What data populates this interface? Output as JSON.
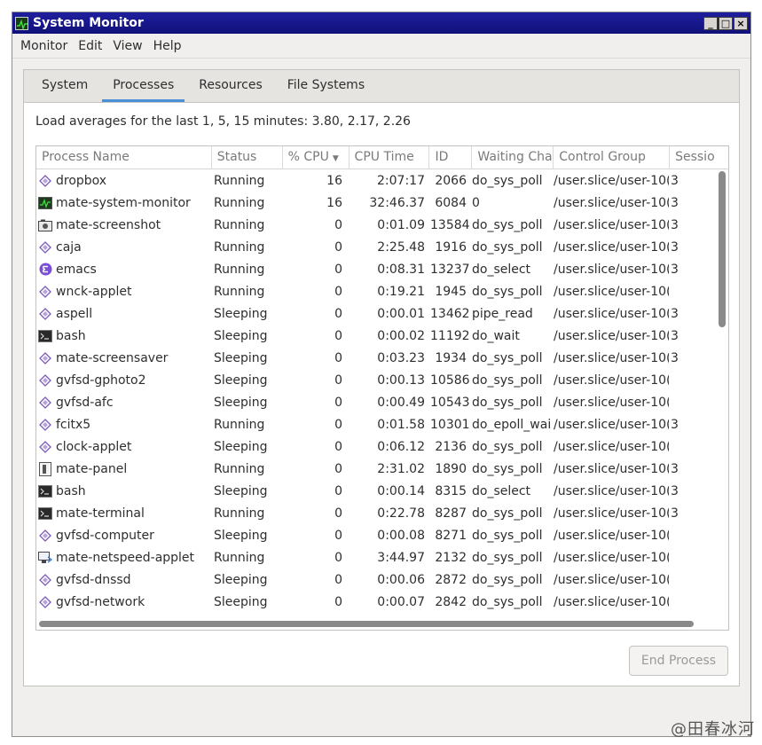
{
  "window": {
    "title": "System Monitor",
    "controls": [
      "_",
      "□",
      "×"
    ]
  },
  "menu": [
    "Monitor",
    "Edit",
    "View",
    "Help"
  ],
  "tabs": [
    "System",
    "Processes",
    "Resources",
    "File Systems"
  ],
  "active_tab": "Processes",
  "load_averages": "Load averages for the last 1, 5, 15 minutes: 3.80, 2.17, 2.26",
  "columns": [
    "Process Name",
    "Status",
    "% CPU",
    "CPU Time",
    "ID",
    "Waiting Cha",
    "Control Group",
    "Sessio"
  ],
  "sort_indicator": "▼",
  "processes": [
    {
      "name": "dropbox",
      "icon": "gear-diamond-icon",
      "status": "Running",
      "cpu": "16",
      "time": "2:07:17",
      "id": "2066",
      "wait": "do_sys_poll",
      "cgroup": "/user.slice/user-10(",
      "sess": "3"
    },
    {
      "name": "mate-system-monitor",
      "icon": "system-monitor-icon",
      "status": "Running",
      "cpu": "16",
      "time": "32:46.37",
      "id": "6084",
      "wait": "0",
      "cgroup": "/user.slice/user-10(",
      "sess": "3"
    },
    {
      "name": "mate-screenshot",
      "icon": "camera-icon",
      "status": "Running",
      "cpu": "0",
      "time": "0:01.09",
      "id": "13584",
      "wait": "do_sys_poll",
      "cgroup": "/user.slice/user-10(",
      "sess": "3"
    },
    {
      "name": "caja",
      "icon": "gear-diamond-icon",
      "status": "Running",
      "cpu": "0",
      "time": "2:25.48",
      "id": "1916",
      "wait": "do_sys_poll",
      "cgroup": "/user.slice/user-10(",
      "sess": "3"
    },
    {
      "name": "emacs",
      "icon": "emacs-icon",
      "status": "Running",
      "cpu": "0",
      "time": "0:08.31",
      "id": "13237",
      "wait": "do_select",
      "cgroup": "/user.slice/user-10(",
      "sess": "3"
    },
    {
      "name": "wnck-applet",
      "icon": "gear-diamond-icon",
      "status": "Running",
      "cpu": "0",
      "time": "0:19.21",
      "id": "1945",
      "wait": "do_sys_poll",
      "cgroup": "/user.slice/user-10(",
      "sess": ""
    },
    {
      "name": "aspell",
      "icon": "gear-diamond-icon",
      "status": "Sleeping",
      "cpu": "0",
      "time": "0:00.01",
      "id": "13462",
      "wait": "pipe_read",
      "cgroup": "/user.slice/user-10(",
      "sess": "3"
    },
    {
      "name": "bash",
      "icon": "terminal-icon",
      "status": "Sleeping",
      "cpu": "0",
      "time": "0:00.02",
      "id": "11192",
      "wait": "do_wait",
      "cgroup": "/user.slice/user-10(",
      "sess": "3"
    },
    {
      "name": "mate-screensaver",
      "icon": "gear-diamond-icon",
      "status": "Sleeping",
      "cpu": "0",
      "time": "0:03.23",
      "id": "1934",
      "wait": "do_sys_poll",
      "cgroup": "/user.slice/user-10(",
      "sess": "3"
    },
    {
      "name": "gvfsd-gphoto2",
      "icon": "gear-diamond-icon",
      "status": "Sleeping",
      "cpu": "0",
      "time": "0:00.13",
      "id": "10586",
      "wait": "do_sys_poll",
      "cgroup": "/user.slice/user-10(",
      "sess": ""
    },
    {
      "name": "gvfsd-afc",
      "icon": "gear-diamond-icon",
      "status": "Sleeping",
      "cpu": "0",
      "time": "0:00.49",
      "id": "10543",
      "wait": "do_sys_poll",
      "cgroup": "/user.slice/user-10(",
      "sess": ""
    },
    {
      "name": "fcitx5",
      "icon": "gear-diamond-icon",
      "status": "Running",
      "cpu": "0",
      "time": "0:01.58",
      "id": "10301",
      "wait": "do_epoll_wai",
      "cgroup": "/user.slice/user-10(",
      "sess": "3"
    },
    {
      "name": "clock-applet",
      "icon": "gear-diamond-icon",
      "status": "Sleeping",
      "cpu": "0",
      "time": "0:06.12",
      "id": "2136",
      "wait": "do_sys_poll",
      "cgroup": "/user.slice/user-10(",
      "sess": ""
    },
    {
      "name": "mate-panel",
      "icon": "panel-icon",
      "status": "Running",
      "cpu": "0",
      "time": "2:31.02",
      "id": "1890",
      "wait": "do_sys_poll",
      "cgroup": "/user.slice/user-10(",
      "sess": "3"
    },
    {
      "name": "bash",
      "icon": "terminal-icon",
      "status": "Sleeping",
      "cpu": "0",
      "time": "0:00.14",
      "id": "8315",
      "wait": "do_select",
      "cgroup": "/user.slice/user-10(",
      "sess": "3"
    },
    {
      "name": "mate-terminal",
      "icon": "terminal-icon",
      "status": "Running",
      "cpu": "0",
      "time": "0:22.78",
      "id": "8287",
      "wait": "do_sys_poll",
      "cgroup": "/user.slice/user-10(",
      "sess": "3"
    },
    {
      "name": "gvfsd-computer",
      "icon": "gear-diamond-icon",
      "status": "Sleeping",
      "cpu": "0",
      "time": "0:00.08",
      "id": "8271",
      "wait": "do_sys_poll",
      "cgroup": "/user.slice/user-10(",
      "sess": ""
    },
    {
      "name": "mate-netspeed-applet",
      "icon": "network-icon",
      "status": "Running",
      "cpu": "0",
      "time": "3:44.97",
      "id": "2132",
      "wait": "do_sys_poll",
      "cgroup": "/user.slice/user-10(",
      "sess": ""
    },
    {
      "name": "gvfsd-dnssd",
      "icon": "gear-diamond-icon",
      "status": "Sleeping",
      "cpu": "0",
      "time": "0:00.06",
      "id": "2872",
      "wait": "do_sys_poll",
      "cgroup": "/user.slice/user-10(",
      "sess": ""
    },
    {
      "name": "gvfsd-network",
      "icon": "gear-diamond-icon",
      "status": "Sleeping",
      "cpu": "0",
      "time": "0:00.07",
      "id": "2842",
      "wait": "do_sys_poll",
      "cgroup": "/user.slice/user-10(",
      "sess": ""
    }
  ],
  "end_process_label": "End Process",
  "watermark": "@田春冰河",
  "colors": {
    "titlebar": "#10107a",
    "tab_active_underline": "#4a90d9",
    "gear_icon": "#7a5ab5",
    "emacs_icon": "#7b4fd6"
  }
}
